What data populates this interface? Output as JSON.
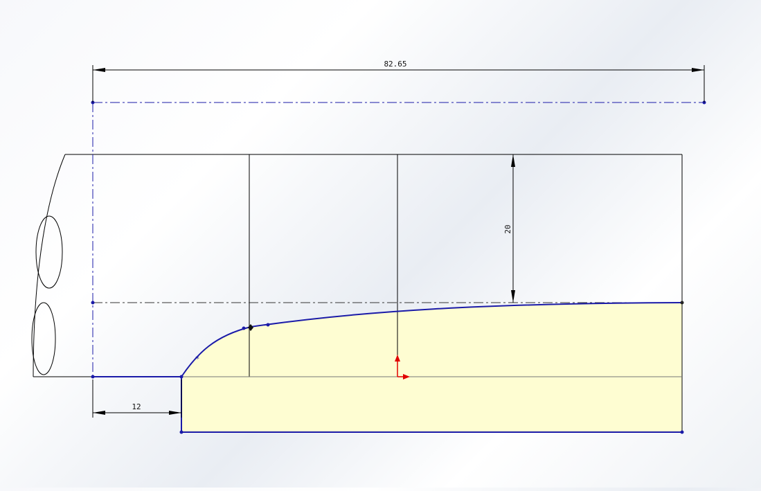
{
  "canvas": {
    "background_gradient": [
      "#f7f8fb",
      "#e9edf3",
      "#ffffff"
    ]
  },
  "dimensions": {
    "overall_length": "82.65",
    "height": "20",
    "offset": "12"
  },
  "colors": {
    "sketch_line": "#1a1aa8",
    "sketch_point": "#1a1aa8",
    "model_edge": "#000000",
    "centerline": "#1a1aa8",
    "fill_region": "#fefdd2",
    "origin_axis": "#e00000"
  }
}
